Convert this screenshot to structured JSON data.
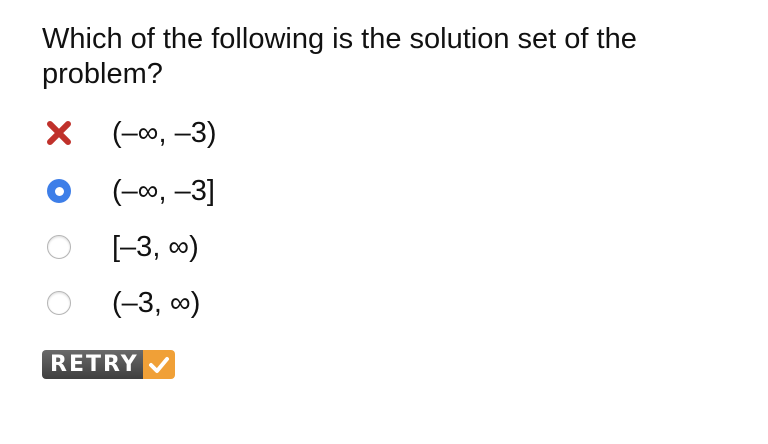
{
  "question": {
    "text": "Which of the following is the solution set of the problem?"
  },
  "options": [
    {
      "label": "(–∞, –3)",
      "state": "incorrect",
      "icon": "x-icon"
    },
    {
      "label": "(–∞, –3]",
      "state": "selected",
      "icon": "radio-selected"
    },
    {
      "label": "[–3, ∞)",
      "state": "unselected",
      "icon": "radio-empty"
    },
    {
      "label": "(–3, ∞)",
      "state": "unselected",
      "icon": "radio-empty"
    }
  ],
  "retry_button": {
    "label": "RETRY",
    "icon": "check-icon"
  },
  "colors": {
    "selected": "#3d7ee8",
    "incorrect": "#c0312b",
    "retry_bg": "#4a4a4a",
    "retry_check": "#f0a037"
  }
}
